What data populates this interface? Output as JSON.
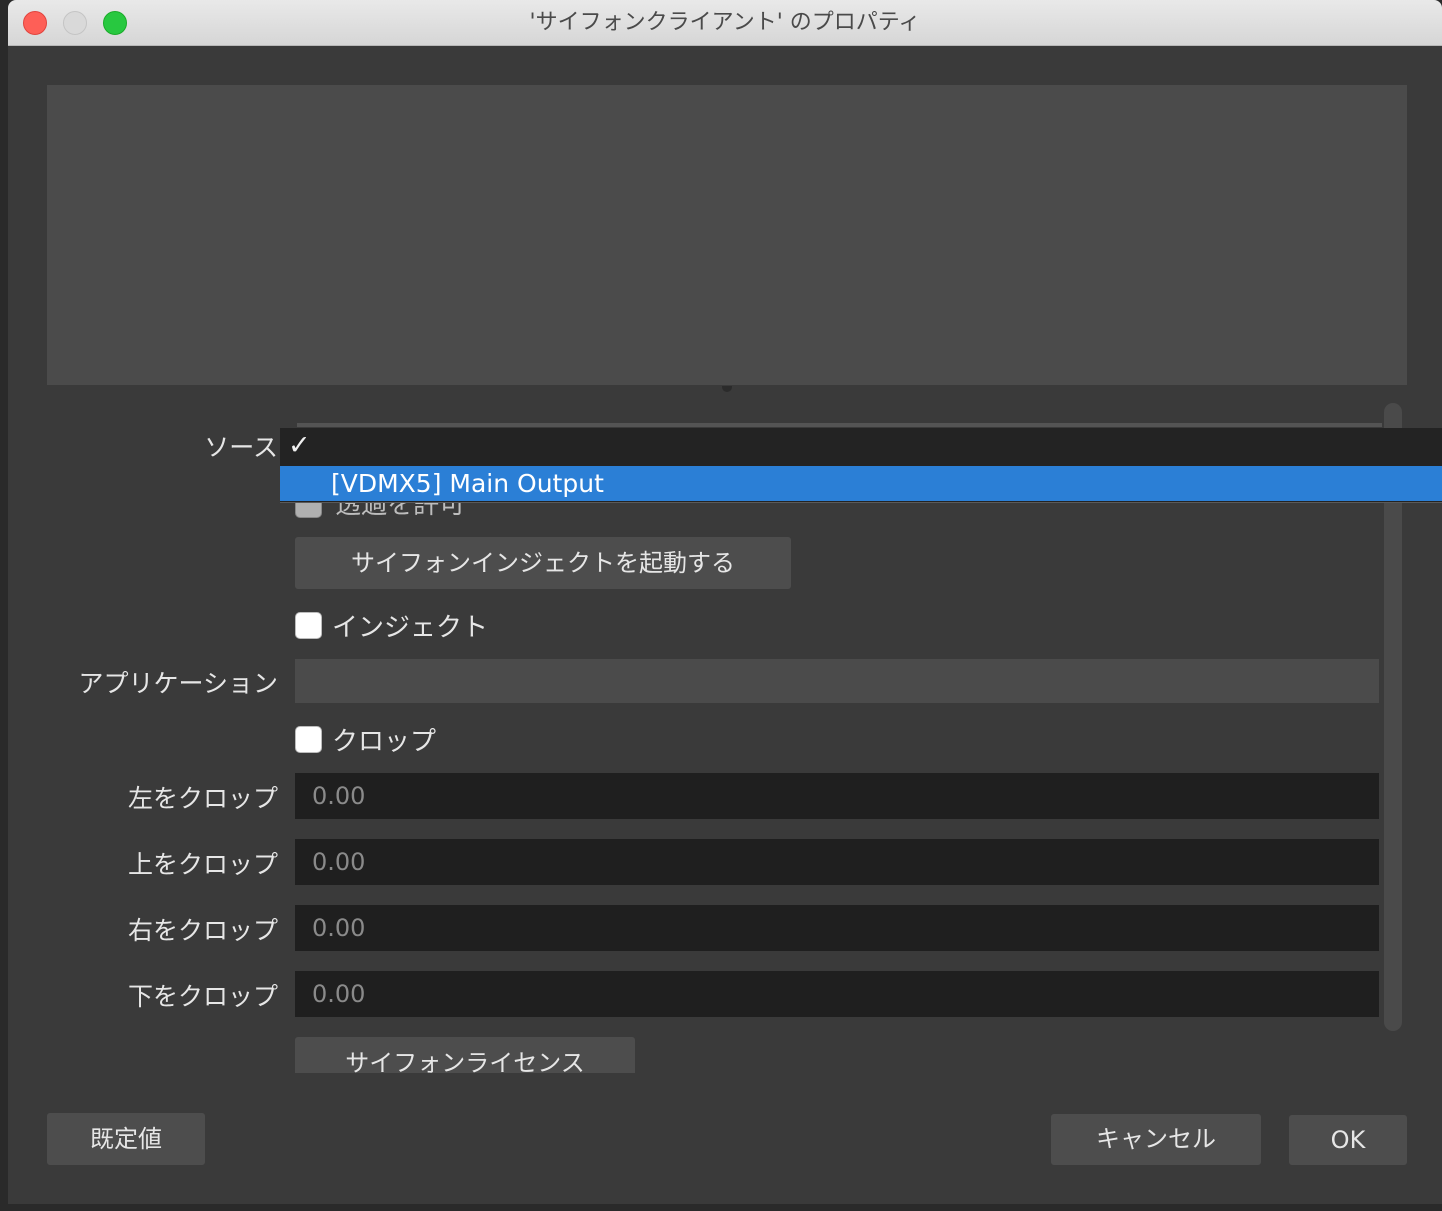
{
  "window": {
    "title": "'サイフォンクライアント' のプロパティ"
  },
  "source": {
    "label": "ソース",
    "checkmark": "✓",
    "selected_option": "[VDMX5] Main Output"
  },
  "allow_transparency": {
    "label": "透過を許可",
    "checked": false
  },
  "launch_inject_button": "サイフォンインジェクトを起動する",
  "inject": {
    "label": "インジェクト",
    "checked": false
  },
  "application": {
    "label": "アプリケーション",
    "value": ""
  },
  "crop": {
    "label": "クロップ",
    "checked": false
  },
  "crop_left": {
    "label": "左をクロップ",
    "value": "0.00"
  },
  "crop_top": {
    "label": "上をクロップ",
    "value": "0.00"
  },
  "crop_right": {
    "label": "右をクロップ",
    "value": "0.00"
  },
  "crop_bottom": {
    "label": "下をクロップ",
    "value": "0.00"
  },
  "license_button": "サイフォンライセンス",
  "footer": {
    "defaults_button": "既定値",
    "cancel_button": "キャンセル",
    "ok_button": "OK"
  },
  "colors": {
    "highlight": "#2b7fd6",
    "close": "#fe5f57",
    "maximize": "#28c840"
  }
}
